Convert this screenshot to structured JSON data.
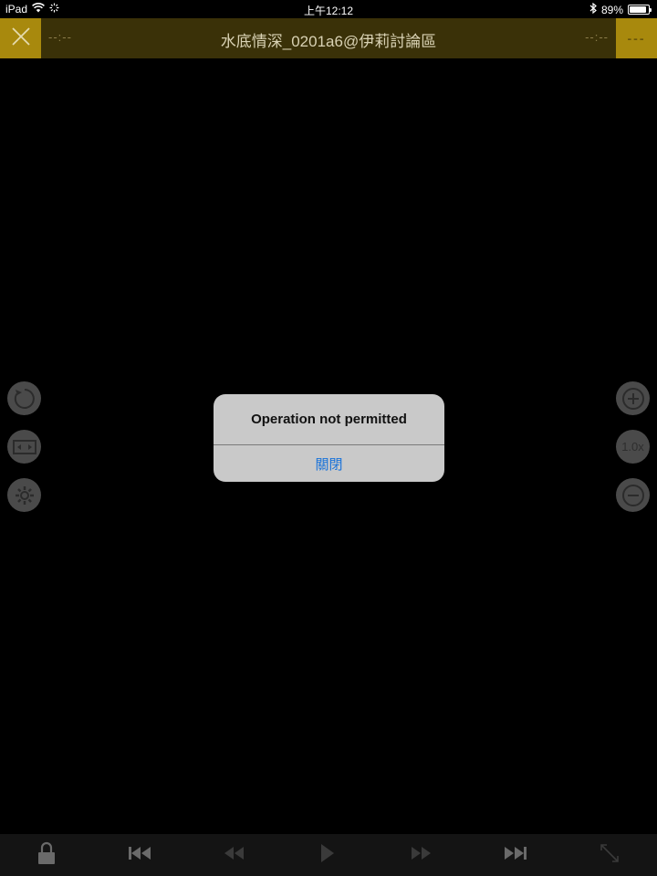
{
  "status_bar": {
    "device": "iPad",
    "time": "上午12:12",
    "battery_percent": "89%",
    "battery_level": 0.89,
    "icons": [
      "wifi-icon",
      "activity-spinner-icon",
      "bluetooth-icon",
      "battery-icon"
    ]
  },
  "top_bar": {
    "close_icon": "close-x-icon",
    "time_elapsed": "--:--",
    "title": "水底情深_0201a6@伊莉討論區",
    "time_remaining": "--:--",
    "menu_label": "---",
    "accent_color": "#a8890d"
  },
  "left_controls": {
    "icons": [
      "rotate-icon",
      "aspect-ratio-icon",
      "settings-icon"
    ]
  },
  "right_controls": {
    "zoom_in_icon": "zoom-in-icon",
    "zoom_level": "1.0x",
    "zoom_out_icon": "zoom-out-icon"
  },
  "alert": {
    "title": "Operation not permitted",
    "close_button": "關閉",
    "button_color": "#1a73d9"
  },
  "bottom_bar": {
    "icons": [
      "lock-icon",
      "skip-previous-icon",
      "rewind-icon",
      "play-icon",
      "fast-forward-icon",
      "skip-next-icon",
      "fullscreen-icon"
    ]
  }
}
